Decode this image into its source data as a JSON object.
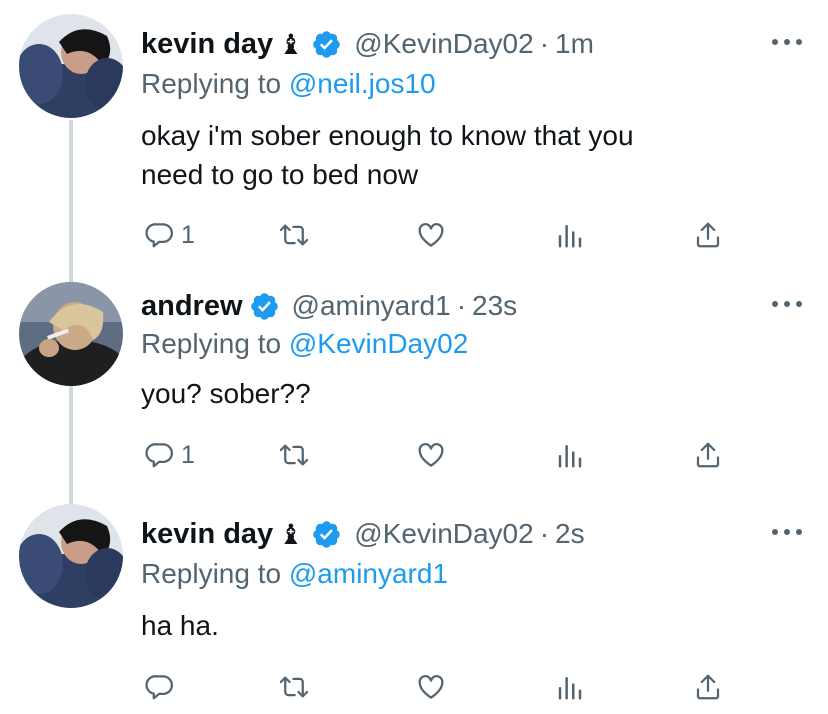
{
  "thread": {
    "tweets": [
      {
        "name": "kevin day",
        "name_emoji": "♝",
        "verified": true,
        "handle": "@KevinDay02",
        "separator": "·",
        "time": "1m",
        "replying_prefix": "Replying to ",
        "replying_to": "@neil.jos10",
        "text_lines": [
          "okay i'm sober enough to know that you",
          "need to go to bed now"
        ],
        "reply_count": "1",
        "avatar": "kevin-avatar"
      },
      {
        "name": "andrew",
        "name_emoji": "",
        "verified": true,
        "handle": "@aminyard1",
        "separator": "·",
        "time": "23s",
        "replying_prefix": "Replying to ",
        "replying_to": "@KevinDay02",
        "text_lines": [
          "you? sober??"
        ],
        "reply_count": "1",
        "avatar": "andrew-avatar"
      },
      {
        "name": "kevin day",
        "name_emoji": "♝",
        "verified": true,
        "handle": "@KevinDay02",
        "separator": "·",
        "time": "2s",
        "replying_prefix": "Replying to ",
        "replying_to": "@aminyard1",
        "text_lines": [
          "ha ha."
        ],
        "reply_count": "",
        "avatar": "kevin-avatar"
      }
    ]
  },
  "icons": {
    "reply": "reply-icon",
    "retweet": "retweet-icon",
    "like": "heart-icon",
    "views": "analytics-icon",
    "share": "share-icon",
    "more": "more-icon",
    "verified": "verified-badge-icon"
  },
  "colors": {
    "text": "#0f1419",
    "secondary": "#536471",
    "accent": "#1d9bf0",
    "thread_line": "#cfd9de"
  }
}
